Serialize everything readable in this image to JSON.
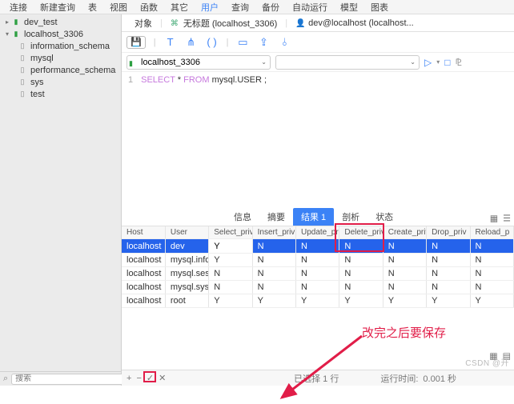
{
  "menu": [
    "连接",
    "新建查询",
    "表",
    "视图",
    "函数",
    "其它",
    "用户",
    "查询",
    "备份",
    "自动运行",
    "模型",
    "图表"
  ],
  "menu_selected": "用户",
  "sidebar": {
    "connections": [
      {
        "label": "dev_test",
        "green": true,
        "expandable": true,
        "expanded": false
      },
      {
        "label": "localhost_3306",
        "green": true,
        "expandable": true,
        "expanded": true
      }
    ],
    "databases": [
      "information_schema",
      "mysql",
      "performance_schema",
      "sys",
      "test"
    ]
  },
  "tabs": [
    "对象",
    "无标题 (localhost_3306)",
    "dev@localhost (localhost..."
  ],
  "combo": "localhost_3306",
  "sql": {
    "line": "1",
    "text_pre": "SELECT",
    "text_mid": " * ",
    "text_from": "FROM",
    "text_post": " mysql.USER ;"
  },
  "subtabs": [
    "信息",
    "摘要",
    "结果 1",
    "剖析",
    "状态"
  ],
  "subtab_active": "结果 1",
  "columns": [
    "Host",
    "User",
    "Select_priv",
    "Insert_priv",
    "Update_priv",
    "Delete_priv",
    "Create_priv",
    "Drop_priv",
    "Reload_p"
  ],
  "rows": [
    {
      "Host": "localhost",
      "User": "dev",
      "Select_priv": "Y",
      "Insert_priv": "N",
      "Update_priv": "N",
      "Delete_priv": "N",
      "Create_priv": "N",
      "Drop_priv": "N",
      "Reload_p": "N",
      "sel": true,
      "edit": true
    },
    {
      "Host": "localhost",
      "User": "mysql.infoschema",
      "Select_priv": "Y",
      "Insert_priv": "N",
      "Update_priv": "N",
      "Delete_priv": "N",
      "Create_priv": "N",
      "Drop_priv": "N",
      "Reload_p": "N"
    },
    {
      "Host": "localhost",
      "User": "mysql.session",
      "Select_priv": "N",
      "Insert_priv": "N",
      "Update_priv": "N",
      "Delete_priv": "N",
      "Create_priv": "N",
      "Drop_priv": "N",
      "Reload_p": "N"
    },
    {
      "Host": "localhost",
      "User": "mysql.sys",
      "Select_priv": "N",
      "Insert_priv": "N",
      "Update_priv": "N",
      "Delete_priv": "N",
      "Create_priv": "N",
      "Drop_priv": "N",
      "Reload_p": "N"
    },
    {
      "Host": "localhost",
      "User": "root",
      "Select_priv": "Y",
      "Insert_priv": "Y",
      "Update_priv": "Y",
      "Delete_priv": "Y",
      "Create_priv": "Y",
      "Drop_priv": "Y",
      "Reload_p": "Y"
    }
  ],
  "annotation_text": "改完之后要保存",
  "status": {
    "selected": "已选择 1 行",
    "time_label": "运行时间:",
    "time": "0.001 秒"
  },
  "search_placeholder": "搜索",
  "watermark": "CSDN @开"
}
